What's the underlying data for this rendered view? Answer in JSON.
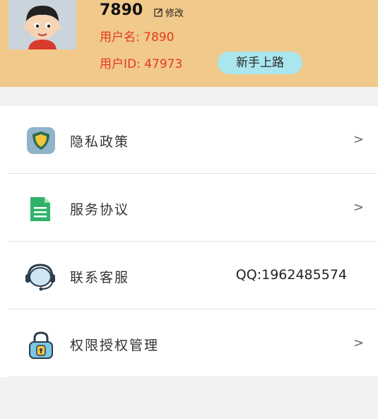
{
  "profile": {
    "username": "7890",
    "edit_label": "修改",
    "username_line": "用户名: 7890",
    "userid_line": "用户ID: 47973",
    "badge_label": "新手上路"
  },
  "menu": {
    "items": [
      {
        "label": "隐私政策",
        "icon": "shield-icon",
        "chevron": ">"
      },
      {
        "label": "服务协议",
        "icon": "document-icon",
        "chevron": ">"
      },
      {
        "label": "联系客服",
        "icon": "headset-icon",
        "value": "QQ:1962485574"
      },
      {
        "label": "权限授权管理",
        "icon": "lock-icon",
        "chevron": ">"
      }
    ]
  },
  "colors": {
    "header_bg": "#f1c98a",
    "accent_red": "#e33a1e",
    "badge_bg": "#a9e6ee"
  }
}
